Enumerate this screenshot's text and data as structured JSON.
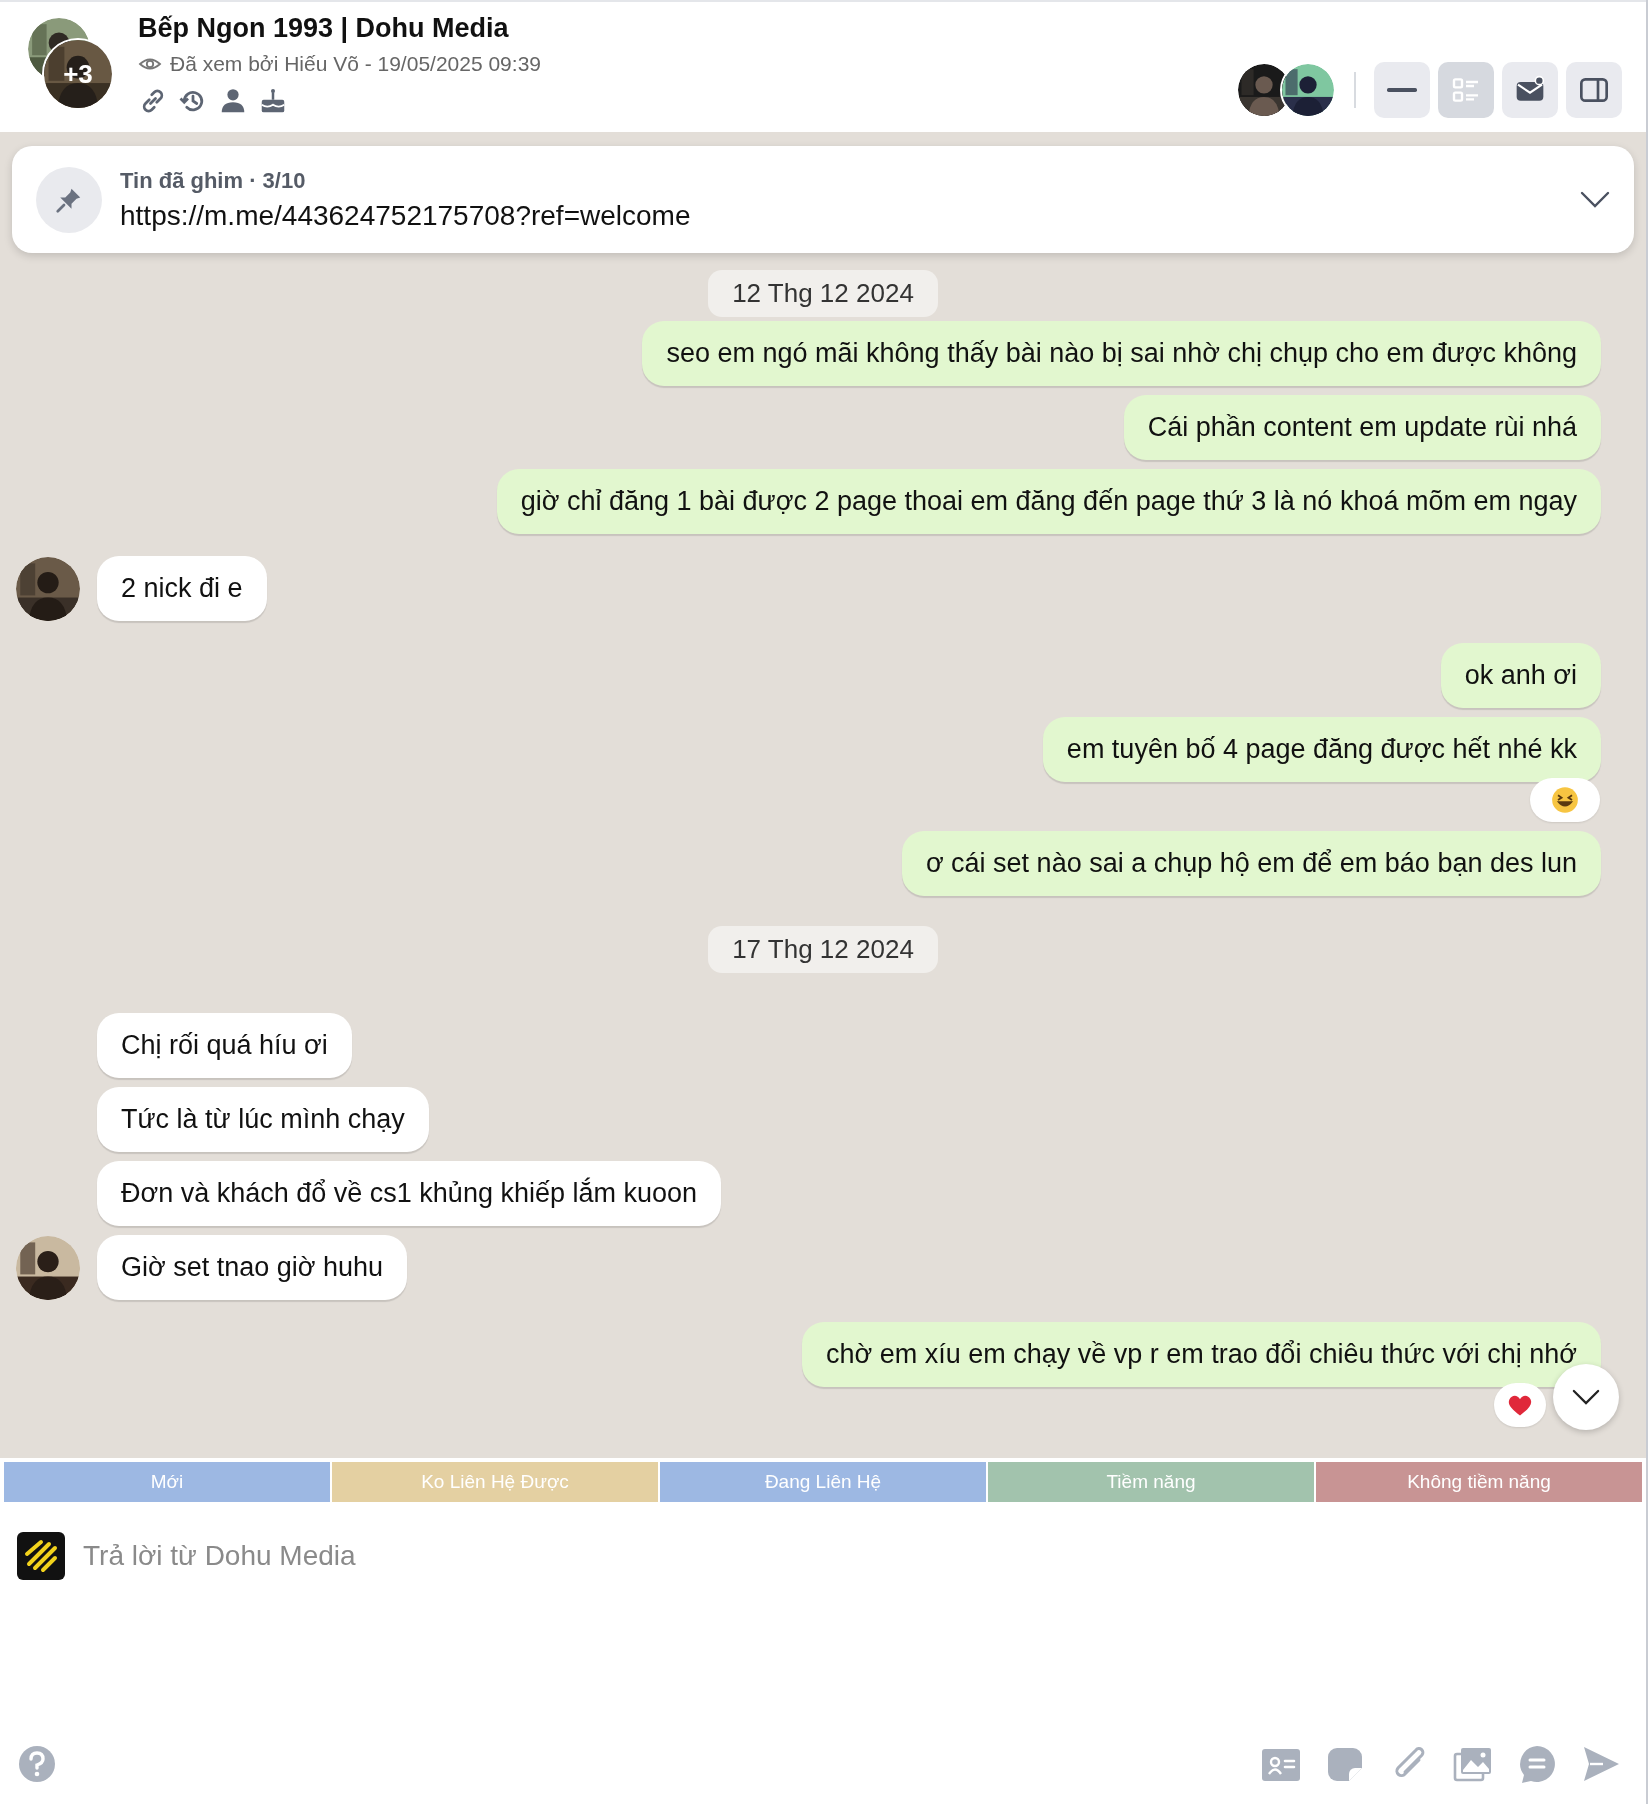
{
  "header": {
    "title": "Bếp Ngon 1993 | Dohu Media",
    "member_overflow": "+3",
    "seen_text": "Đã xem bởi Hiếu Võ - 19/05/2025 09:39",
    "toolbar": [
      {
        "kind": "minimize",
        "selected": false
      },
      {
        "kind": "list",
        "selected": true
      },
      {
        "kind": "inbox",
        "selected": false
      },
      {
        "kind": "panel",
        "selected": false
      }
    ]
  },
  "pinned": {
    "label": "Tin đã ghim · 3/10",
    "text": "https://m.me/443624752175708?ref=welcome"
  },
  "messages": [
    {
      "kind": "date",
      "text": "12 Thg 12 2024"
    },
    {
      "kind": "outgoing",
      "text": "seo em ngó mãi không thấy bài nào bị sai nhờ chị chụp cho em được không"
    },
    {
      "kind": "outgoing",
      "text": "Cái phần content em update rùi nhá"
    },
    {
      "kind": "outgoing",
      "text": "giờ chỉ đăng 1 bài được 2 page thoai em đăng đến page thứ 3 là nó khoá mõm em ngay"
    },
    {
      "kind": "incoming",
      "text": "2 nick đi e",
      "avatar": true
    },
    {
      "kind": "outgoing",
      "text": "ok anh ơi"
    },
    {
      "kind": "outgoing",
      "text": "em tuyên bố 4 page đăng được hết nhé kk",
      "reaction": {
        "kind": "laugh"
      }
    },
    {
      "kind": "outgoing",
      "text": "ơ cái set nào sai a chụp hộ em để em báo bạn des lun"
    },
    {
      "kind": "date",
      "text": "17 Thg 12 2024"
    },
    {
      "kind": "incoming",
      "text": "Chị rối quá híu ơi",
      "avatar": false
    },
    {
      "kind": "incoming",
      "text": "Tức là từ lúc mình chạy",
      "avatar": false
    },
    {
      "kind": "incoming",
      "text": "Đơn và khách đổ về cs1 khủng khiếp lắm kuoon",
      "avatar": false
    },
    {
      "kind": "incoming",
      "text": "Giờ set tnao giờ huhu",
      "avatar": true
    },
    {
      "kind": "outgoing",
      "text": "chờ em xíu em chạy về vp r em trao đổi chiêu thức với chị nhớ",
      "reaction": {
        "kind": "heart"
      }
    }
  ],
  "tags": [
    {
      "label": "Mới",
      "color": "#9db8e3"
    },
    {
      "label": "Ko Liên Hệ Được",
      "color": "#e4d0a2"
    },
    {
      "label": "Đang Liên Hệ",
      "color": "#9db8e3"
    },
    {
      "label": "Tiềm năng",
      "color": "#a2c3ad"
    },
    {
      "label": "Không tiềm năng",
      "color": "#c89494"
    }
  ],
  "composer": {
    "placeholder": "Trả lời từ Dohu Media"
  }
}
